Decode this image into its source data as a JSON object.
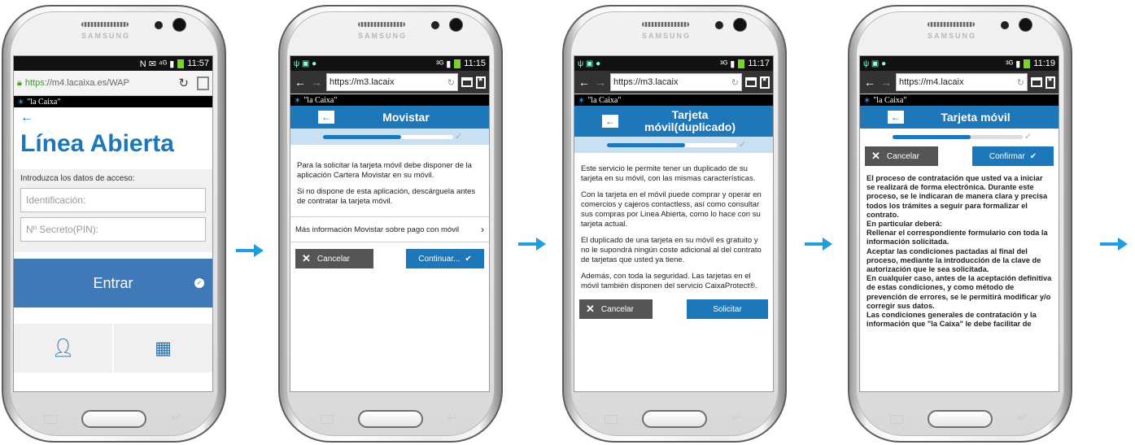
{
  "phones": [
    {
      "brand": "SAMSUNG",
      "status_time": "11:57",
      "url": "https://m4.lacaixa.es/WAP",
      "url_https": "https",
      "url_rest": "://m4.lacaixa.es/WAP",
      "logo": "\"la Caixa\"",
      "back_glyph": "←",
      "heading": "Línea Abierta",
      "form_label": "Introduzca los datos de acceso:",
      "id_placeholder": "Identificación:",
      "pin_placeholder": "Nº Secreto(PIN):",
      "enter_button": "Entrar"
    },
    {
      "brand": "SAMSUNG",
      "status_time": "11:15",
      "url": "https://m3.lacaix",
      "logo": "\"la Caixa\"",
      "header_title": "Movistar",
      "progress": 0.6,
      "para1": "Para la solicitar la tarjeta móvil debe disponer de la aplicación Cartera Movistar en su móvil.",
      "para2": "Si no dispone de esta aplicación, descárguela antes de contratar la tarjeta móvil.",
      "more_info": "Más información Movistar sobre pago con móvil",
      "cancel": "Cancelar",
      "continue": "Continuar..."
    },
    {
      "brand": "SAMSUNG",
      "status_time": "11:17",
      "url": "https://m3.lacaix",
      "logo": "\"la Caixa\"",
      "header_title_line1": "Tarjeta",
      "header_title_line2": "móvil(duplicado)",
      "progress": 0.6,
      "para1": "Este servicio le permite tener un duplicado de su tarjeta en su móvil, con las mismas características.",
      "para2": "Con la tarjeta en el móvil puede comprar y operar en comercios y cajeros contactless, así como consultar sus compras por Linea Abierta, como lo hace con su tarjeta actual.",
      "para3": "El duplicado de una tarjeta en su móvil es gratuito y no le supondrá ningún coste adicional al del contrato de tarjetas que usted ya tiene.",
      "para4": "Además, con toda la seguridad. Las tarjetas en el móvil también disponen del servicio CaixaProtect®.",
      "cancel": "Cancelar",
      "submit": "Solicitar"
    },
    {
      "brand": "SAMSUNG",
      "status_time": "11:19",
      "url": "https://m4.lacaix",
      "logo": "\"la Caixa\"",
      "header_title": "Tarjeta móvil",
      "progress": 0.6,
      "cancel": "Cancelar",
      "confirm": "Confirmar",
      "text": "El proceso de contratación que usted va a iniciar se realizará de forma electrónica. Durante este proceso, se le indicaran de manera clara y precisa todos los trámites a seguir para formalizar el contrato.\nEn particular deberá:\nRellenar el correspondiente formulario con toda la información solicitada.\nAceptar las condiciones pactadas al final del proceso, mediante la introducción de la clave de autorización que le sea solicitada.\nEn cualquier caso, antes de la aceptación definitiva de estas condiciones, y como método de prevención de errores, se le permitirá modificar y/o corregir sus datos.\nLas condiciones generales de contratación y la información que \"la Caixa\" le debe facilitar de"
    }
  ],
  "colors": {
    "brand_blue": "#1d77b9",
    "arrow_blue": "#1e9ee0",
    "progress_bg": "#c8e0f1"
  }
}
